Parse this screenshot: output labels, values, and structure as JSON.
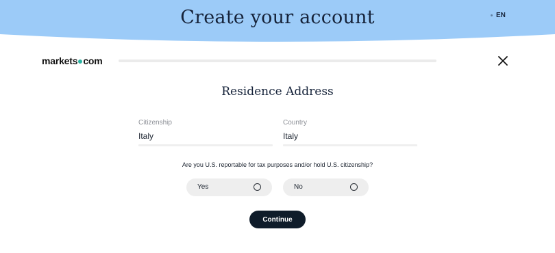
{
  "banner": {
    "title": "Create your account",
    "language": "EN",
    "background_color": "#9ccbf8"
  },
  "header": {
    "logo_part1": "markets",
    "logo_part2": "com",
    "logo_dot_color": "#2bb3a3",
    "progress": 0.0,
    "close_icon": "close-icon"
  },
  "form": {
    "section_title": "Residence Address",
    "citizenship": {
      "label": "Citizenship",
      "value": "Italy"
    },
    "country": {
      "label": "Country",
      "value": "Italy"
    },
    "question": "Are you U.S. reportable for tax purposes and/or hold U.S. citizenship?",
    "options": [
      {
        "label": "Yes",
        "selected": false
      },
      {
        "label": "No",
        "selected": false
      }
    ],
    "continue_label": "Continue",
    "continue_color": "#0f1c2a"
  }
}
